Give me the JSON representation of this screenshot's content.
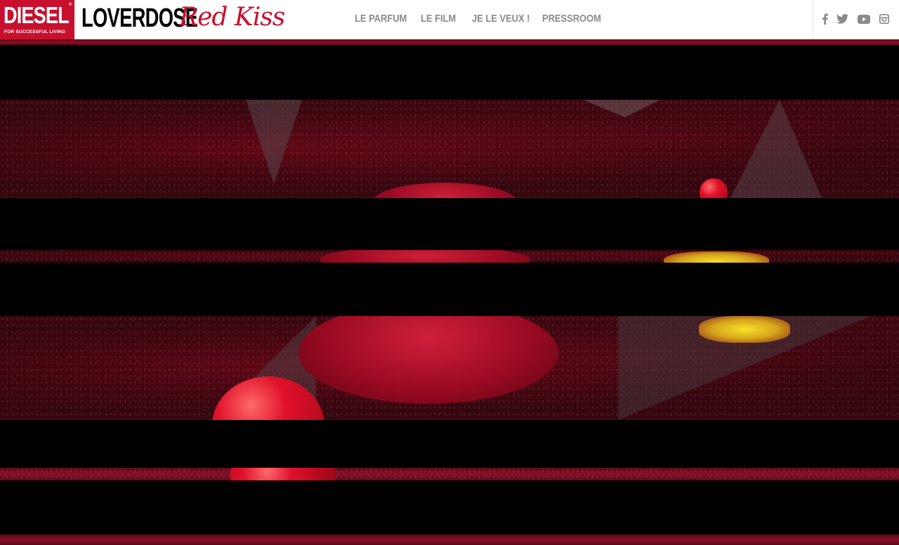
{
  "brand": {
    "diesel_word": "DIESEL",
    "diesel_tagline": "FOR SUCCESSFUL LIVING",
    "diesel_reg": "®",
    "product_name": "LOVERDOSE",
    "product_sub": "Red Kiss"
  },
  "nav": {
    "items": [
      {
        "label": "LE PARFUM"
      },
      {
        "label": "LE FILM"
      },
      {
        "label": "JE LE VEUX !"
      },
      {
        "label": "PRESSROOM"
      }
    ]
  },
  "social": [
    "facebook-icon",
    "twitter-icon",
    "youtube-icon",
    "instagram-icon"
  ],
  "colors": {
    "brand_red": "#c8102e",
    "nav_gray": "#8a8a8a",
    "header_bg": "#ffffff",
    "hero_bg": "#000000"
  }
}
